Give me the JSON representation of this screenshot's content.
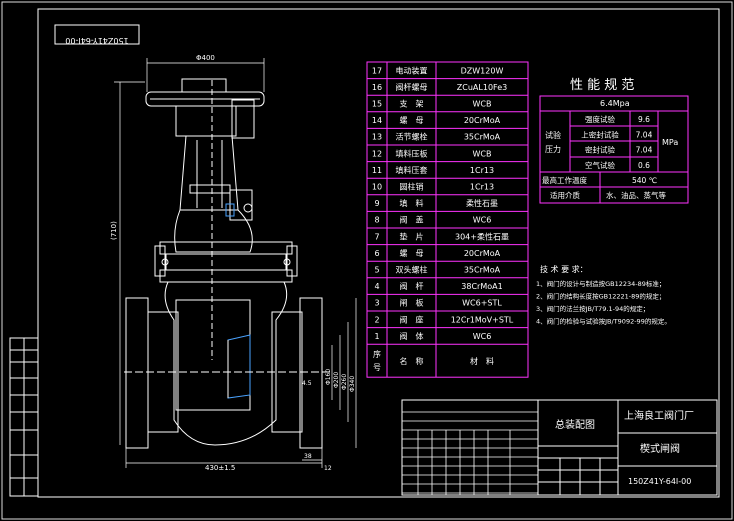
{
  "drawing_no_rotated": "150Z41Y-64I-00",
  "dims": {
    "top_width": "Φ400",
    "height": "(710)",
    "bottom_width": "430±1.5",
    "d1": "Φ160",
    "d2": "Φ200",
    "d3": "Φ260",
    "d4": "Φ340",
    "h_small1": "4.5",
    "h_small2": "38",
    "h_small3": "12"
  },
  "parts_table": {
    "rows": [
      {
        "no": "17",
        "name": "电动装置",
        "material": "DZW120W"
      },
      {
        "no": "16",
        "name": "阀杆螺母",
        "material": "ZCuAL10Fe3"
      },
      {
        "no": "15",
        "name": "支　架",
        "material": "WCB"
      },
      {
        "no": "14",
        "name": "螺　母",
        "material": "20CrMoA"
      },
      {
        "no": "13",
        "name": "活节螺栓",
        "material": "35CrMoA"
      },
      {
        "no": "12",
        "name": "填料压板",
        "material": "WCB"
      },
      {
        "no": "11",
        "name": "填料压套",
        "material": "1Cr13"
      },
      {
        "no": "10",
        "name": "圆柱销",
        "material": "1Cr13"
      },
      {
        "no": "9",
        "name": "填　料",
        "material": "柔性石墨"
      },
      {
        "no": "8",
        "name": "阀　盖",
        "material": "WC6"
      },
      {
        "no": "7",
        "name": "垫　片",
        "material": "304+柔性石墨"
      },
      {
        "no": "6",
        "name": "螺　母",
        "material": "20CrMoA"
      },
      {
        "no": "5",
        "name": "双头螺柱",
        "material": "35CrMoA"
      },
      {
        "no": "4",
        "name": "阀　杆",
        "material": "38CrMoA1"
      },
      {
        "no": "3",
        "name": "闸　板",
        "material": "WC6+STL"
      },
      {
        "no": "2",
        "name": "阀　座",
        "material": "12Cr1MoV+STL"
      },
      {
        "no": "1",
        "name": "阀　体",
        "material": "WC6"
      }
    ],
    "header_no": "序号",
    "header_name": "名　称",
    "header_material": "材　料"
  },
  "performance": {
    "title": "性 能 规 范",
    "pressure": "6.4Mpa",
    "test_label": "试验压力",
    "unit": "MPa",
    "rows": [
      {
        "label": "强度试验",
        "value": "9.6"
      },
      {
        "label": "上密封试验",
        "value": "7.04"
      },
      {
        "label": "密封试验",
        "value": "7.04"
      },
      {
        "label": "空气试验",
        "value": "0.6"
      }
    ],
    "max_temp_label": "最高工作温度",
    "max_temp_value": "540 ℃",
    "medium_label": "适用介质",
    "medium_value": "水、油品、蒸气等"
  },
  "requirements": {
    "title": "技 术 要 求：",
    "items": [
      "1、阀门的设计与制造按GB12234-89标准；",
      "2、阀门的结构长度按GB12221-89的规定；",
      "3、阀门的法兰按JB/T79.1-94的规定；",
      "4、阀门的检验与试验按JB/T9092-99的规定。"
    ]
  },
  "title_block": {
    "company": "上海良工阀门厂",
    "drawing_title": "总装配图",
    "product": "楔式闸阀",
    "code": "150Z41Y-64I-00"
  }
}
